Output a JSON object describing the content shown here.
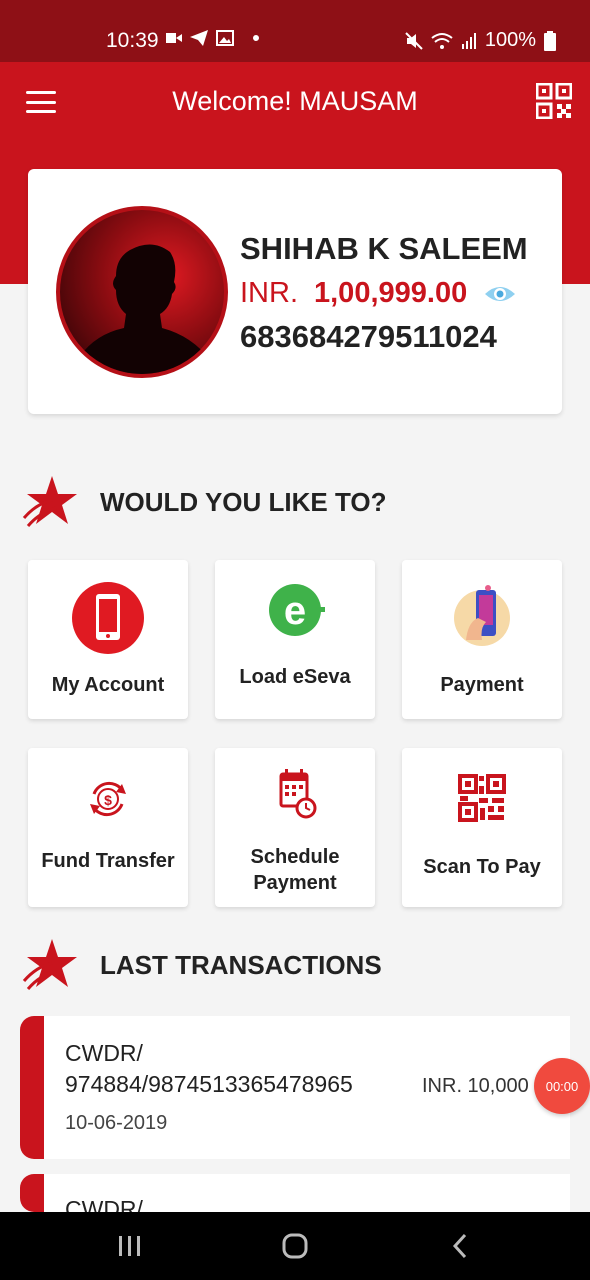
{
  "status_bar": {
    "time": "10:39",
    "battery": "100%",
    "icons_left": [
      "video-icon",
      "send-icon",
      "image-icon",
      "dot-icon"
    ],
    "icons_right": [
      "mute-icon",
      "wifi-icon",
      "signal-icon",
      "battery-icon"
    ]
  },
  "app_bar": {
    "title": "Welcome! MAUSAM",
    "menu_icon": "hamburger-menu-icon",
    "qr_icon": "qr-code-icon",
    "color": "#c9141d"
  },
  "profile": {
    "name": "SHIHAB K SALEEM",
    "currency": "INR.",
    "balance": "1,00,999.00",
    "account_number": "683684279511024",
    "eye_icon": "eye-icon"
  },
  "actions_section": {
    "title": "WOULD YOU LIKE TO?",
    "items": [
      {
        "label": "My Account",
        "icon": "mobile-phone-icon"
      },
      {
        "label": "Load eSeva",
        "icon": "eseva-icon"
      },
      {
        "label": "Payment",
        "icon": "mobile-payment-icon"
      },
      {
        "label": "Fund Transfer",
        "icon": "dollar-transfer-icon"
      },
      {
        "label": "Schedule Payment",
        "icon": "calendar-clock-icon"
      },
      {
        "label": "Scan To Pay",
        "icon": "qr-scan-icon"
      }
    ]
  },
  "transactions_section": {
    "title": "LAST TRANSACTIONS",
    "items": [
      {
        "line1": "CWDR/",
        "line2": "974884/9874513365478965",
        "date": "10-06-2019",
        "amount": "INR. 10,000"
      },
      {
        "line1": "CWDR/"
      }
    ]
  },
  "timer_badge": "00:00",
  "nav_bar": {
    "buttons": [
      "recent-apps-icon",
      "home-icon",
      "back-icon"
    ]
  }
}
